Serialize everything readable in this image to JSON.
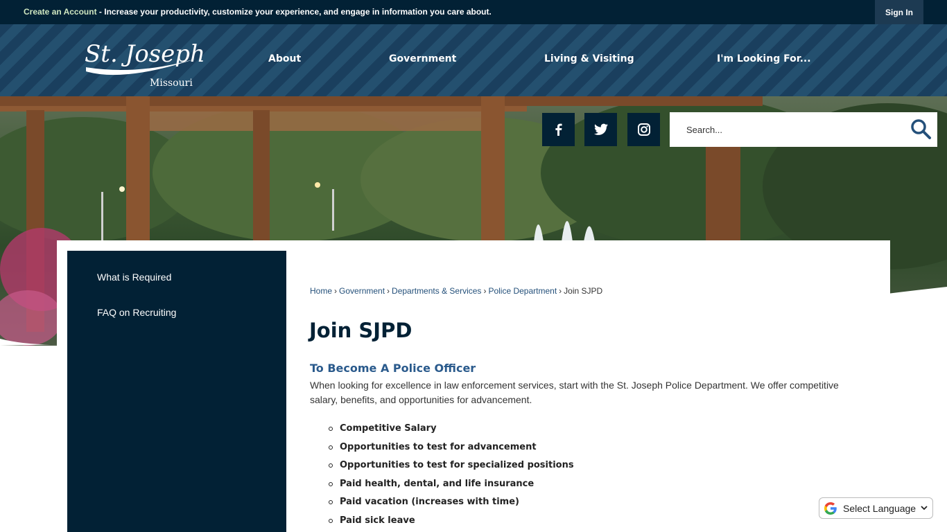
{
  "topbar": {
    "create_account": "Create an Account",
    "message": " - Increase your productivity, customize your experience, and engage in information you care about.",
    "sign_in": "Sign In"
  },
  "logo": {
    "line1": "St. Joseph",
    "line2": "Missouri"
  },
  "nav": [
    "About",
    "Government",
    "Living & Visiting",
    "I'm Looking For..."
  ],
  "social": [
    "facebook-icon",
    "twitter-icon",
    "instagram-icon"
  ],
  "search": {
    "placeholder": "Search..."
  },
  "sidebar": {
    "items": [
      "What is Required",
      "FAQ on Recruiting"
    ]
  },
  "breadcrumb": [
    "Home",
    "Government",
    "Departments & Services",
    "Police Department",
    "Join SJPD"
  ],
  "page": {
    "title": "Join SJPD",
    "section_title": "To Become A Police Officer",
    "intro": "When looking for excellence in law enforcement services, start with the St. Joseph Police Department. We offer competitive salary, benefits, and opportunities for advancement.",
    "benefits": [
      "Competitive Salary",
      "Opportunities to test for advancement",
      "Opportunities to test for specialized positions",
      "Paid health, dental, and life insurance",
      "Paid vacation (increases with time)",
      "Paid sick leave"
    ]
  },
  "translate": {
    "label": "Select Language"
  },
  "colors": {
    "navy": "#022135",
    "header_blue": "#1a3f5e",
    "link_blue": "#24507a",
    "heading_blue": "#2a5a8c"
  }
}
